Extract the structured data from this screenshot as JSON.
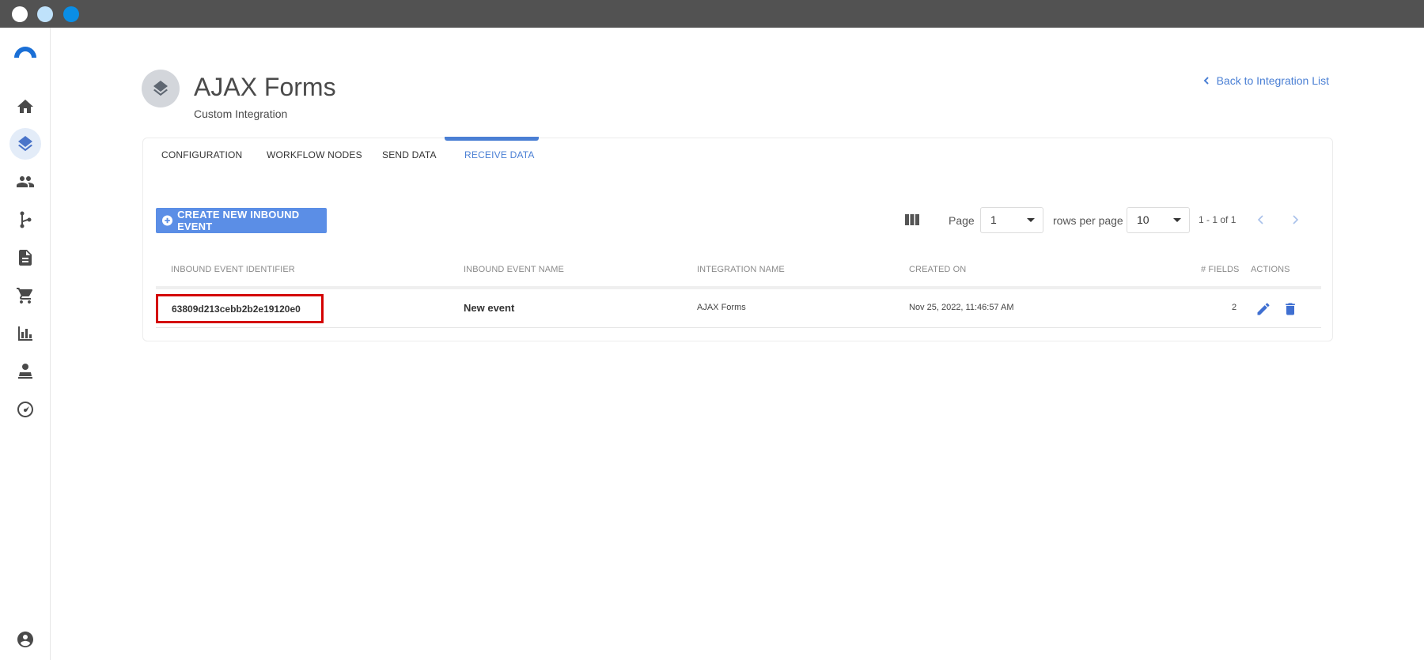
{
  "window": {
    "dots": [
      "#ffffff",
      "#bfe2fb",
      "#0a8ee6"
    ]
  },
  "sidebar": {
    "items": [
      {
        "icon": "home-icon"
      },
      {
        "icon": "layers-icon",
        "active": true
      },
      {
        "icon": "people-icon"
      },
      {
        "icon": "fork-icon"
      },
      {
        "icon": "document-icon"
      },
      {
        "icon": "cart-icon"
      },
      {
        "icon": "bar-chart-icon"
      },
      {
        "icon": "agent-icon"
      },
      {
        "icon": "gauge-icon"
      }
    ],
    "footer_icon": "account-icon"
  },
  "header": {
    "title": "AJAX Forms",
    "subtitle": "Custom Integration",
    "back_link": "Back to Integration List"
  },
  "tabs": [
    {
      "label": "CONFIGURATION"
    },
    {
      "label": "WORKFLOW NODES"
    },
    {
      "label": "SEND DATA"
    },
    {
      "label": "RECEIVE DATA",
      "active": true
    }
  ],
  "toolbar": {
    "create_button": "CREATE NEW INBOUND EVENT",
    "page_label": "Page",
    "page_value": "1",
    "rows_label": "rows per page",
    "rows_value": "10",
    "range_text": "1 - 1 of 1"
  },
  "table": {
    "headers": [
      "INBOUND EVENT IDENTIFIER",
      "INBOUND EVENT NAME",
      "INTEGRATION NAME",
      "CREATED ON",
      "# FIELDS",
      "ACTIONS"
    ],
    "rows": [
      {
        "identifier": "63809d213cebb2b2e19120e0",
        "name": "New event",
        "integration": "AJAX Forms",
        "created_on": "Nov 25, 2022, 11:46:57 AM",
        "fields": "2"
      }
    ]
  },
  "colors": {
    "accent": "#4a7fd4",
    "button": "#5b8ee6",
    "highlight": "#d40000"
  }
}
